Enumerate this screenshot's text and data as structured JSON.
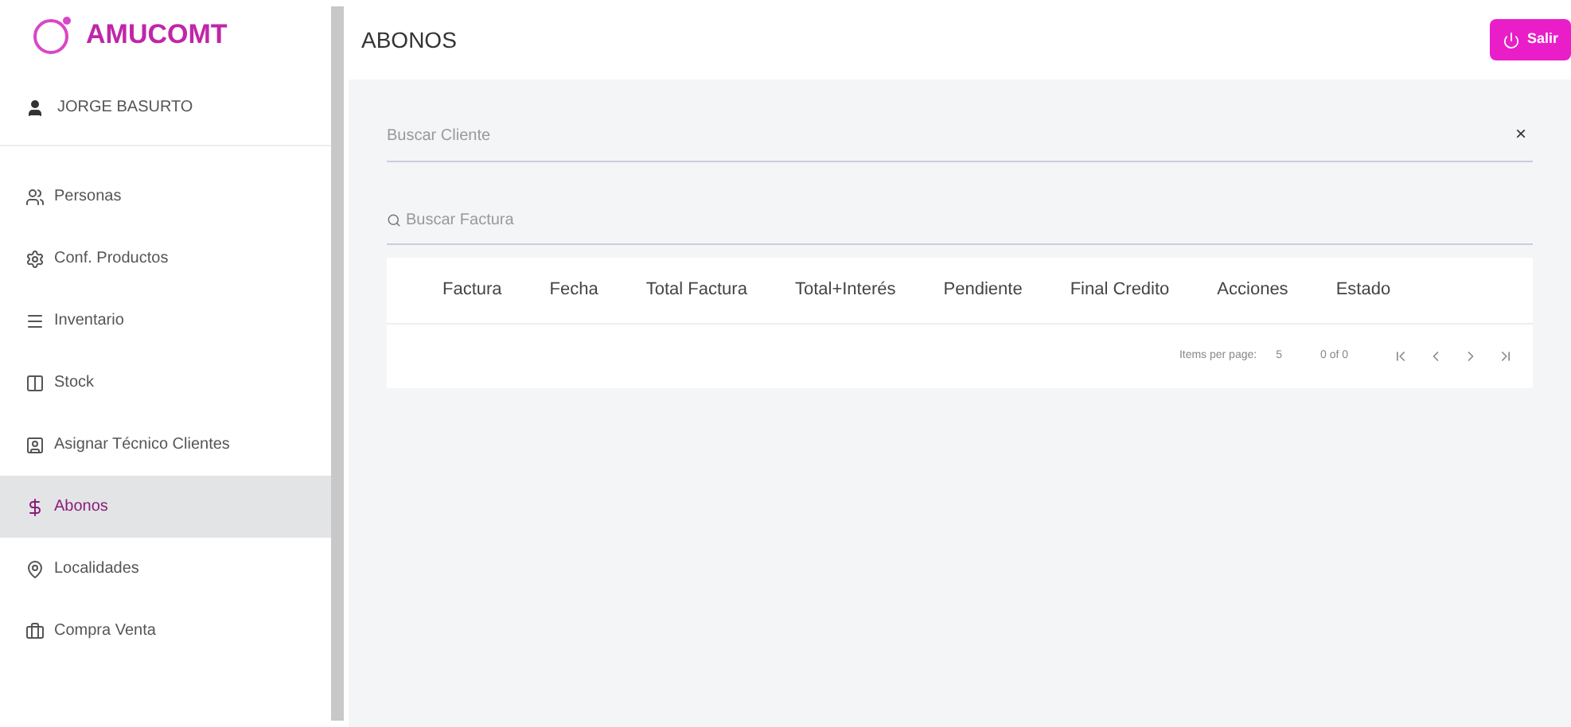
{
  "brand": {
    "name": "AMUCOMT"
  },
  "user": {
    "name": "JORGE BASURTO"
  },
  "sidebar": {
    "items": [
      {
        "label": "Personas",
        "selected": false
      },
      {
        "label": "Conf. Productos",
        "selected": false
      },
      {
        "label": "Inventario",
        "selected": false
      },
      {
        "label": "Stock",
        "selected": false
      },
      {
        "label": "Asignar Técnico Clientes",
        "selected": false
      },
      {
        "label": "Abonos",
        "selected": true
      },
      {
        "label": "Localidades",
        "selected": false
      },
      {
        "label": "Compra Venta",
        "selected": false
      }
    ]
  },
  "header": {
    "title": "ABONOS",
    "logout": "Salir"
  },
  "client_search": {
    "placeholder": "Buscar Cliente",
    "clear": "×"
  },
  "invoice_search": {
    "placeholder": "Buscar Factura"
  },
  "table": {
    "columns": [
      "Factura",
      "Fecha",
      "Total Factura",
      "Total+Interés",
      "Pendiente",
      "Final Credito",
      "Acciones",
      "Estado"
    ]
  },
  "paginator": {
    "items_per_page_label": "Items per page:",
    "items_per_page": "5",
    "range": "0 of 0"
  }
}
